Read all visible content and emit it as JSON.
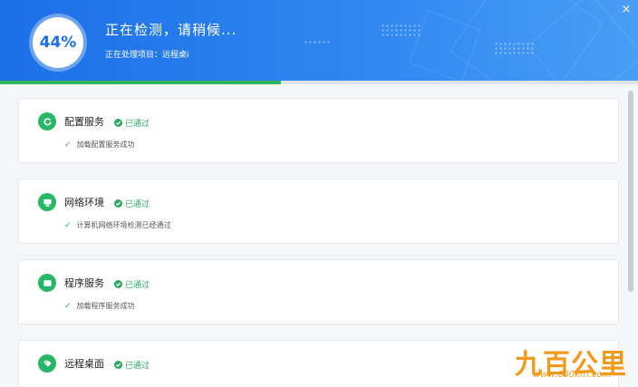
{
  "header": {
    "percent": "44%",
    "title": "正在检测，请稍候...",
    "subtitle": "正在处理项目：远程桌i",
    "close": "×",
    "progress": 0.44
  },
  "items": [
    {
      "name": "配置服务",
      "status": "已通过",
      "detail": "加载配置服务成功",
      "icon": "refresh-icon"
    },
    {
      "name": "网络环境",
      "status": "已通过",
      "detail": "计算机网络环境检测已经通过",
      "icon": "monitor-icon"
    },
    {
      "name": "程序服务",
      "status": "已通过",
      "detail": "加载程序服务成功",
      "icon": "window-icon"
    },
    {
      "name": "远程桌面",
      "status": "已通过",
      "detail": "",
      "icon": "tag-icon"
    }
  ],
  "watermark": {
    "logo": "九百公里",
    "url": "www.600km.com"
  },
  "colors": {
    "header": "#1c6fe6",
    "accent_green": "#2ba85f",
    "progress": "#2fb65c"
  }
}
